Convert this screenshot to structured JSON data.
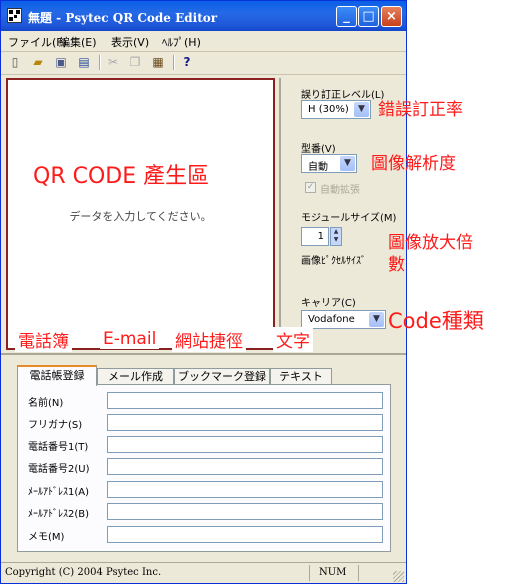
{
  "window": {
    "title": "無題 - Psytec QR Code Editor"
  },
  "titlebar": {
    "minimize": "_",
    "maximize": "□",
    "close": "×"
  },
  "menubar": {
    "items": [
      "ファイル(F)",
      "編集(E)",
      "表示(V)",
      "ﾍﾙﾌﾟ(H)"
    ]
  },
  "toolbar": {
    "icons": [
      "new-icon",
      "open-icon",
      "save-icon",
      "print-preview-icon",
      "cut-icon",
      "copy-icon",
      "paste-icon",
      "help-icon"
    ]
  },
  "canvas": {
    "message": "データを入力してください。"
  },
  "right_panel": {
    "error_correction": {
      "label": "誤り訂正レベル(L)",
      "value": "H (30%)"
    },
    "model": {
      "label": "型番(V)",
      "value": "自動"
    },
    "auto_expand": {
      "label": "自動拡張",
      "checked": true,
      "enabled": false
    },
    "module_size": {
      "label": "モジュールサイズ(M)",
      "value": "1",
      "unit_label": "画像ﾋﾟｸｾﾙｻｲｽﾞ"
    },
    "carrier": {
      "label": "キャリア(C)",
      "value": "Vodafone"
    }
  },
  "tabs": [
    "電話帳登録",
    "メール作成",
    "ブックマーク登録",
    "テキスト"
  ],
  "active_tab": 0,
  "form": {
    "fields": [
      {
        "label": "名前(N)",
        "value": ""
      },
      {
        "label": "フリガナ(S)",
        "value": ""
      },
      {
        "label": "電話番号1(T)",
        "value": ""
      },
      {
        "label": "電話番号2(U)",
        "value": ""
      },
      {
        "label": "ﾒｰﾙｱﾄﾞﾚｽ1(A)",
        "value": ""
      },
      {
        "label": "ﾒｰﾙｱﾄﾞﾚｽ2(B)",
        "value": ""
      },
      {
        "label": "メモ(M)",
        "value": ""
      }
    ]
  },
  "statusbar": {
    "copyright": "Copyright (C) 2004 Psytec Inc.",
    "num": "NUM"
  },
  "annotations": {
    "qr_area": "QR CODE 產生區",
    "error_correction": "錯誤訂正率",
    "resolution": "圖像解析度",
    "zoom_line1": "圖像放大倍",
    "zoom_line2": "數",
    "code_type": "Code種類",
    "phonebook": "電話簿",
    "email": "E-mail",
    "bookmark": "網站捷徑",
    "text": "文字"
  },
  "colors": {
    "annotation": "#ff1a1a",
    "titlebar": "#0a5fe8",
    "active_tab_accent": "#e68b2c"
  }
}
